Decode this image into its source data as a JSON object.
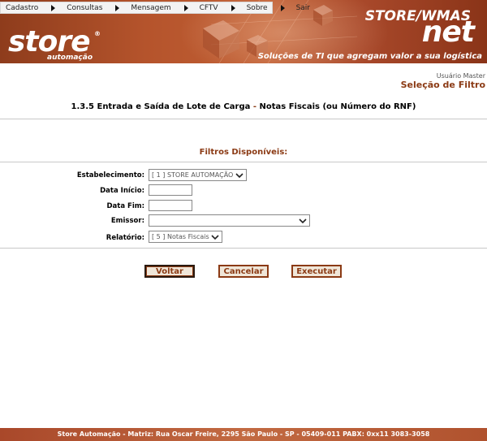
{
  "menu": {
    "items": [
      {
        "label": "Cadastro"
      },
      {
        "label": "Consultas"
      },
      {
        "label": "Mensagem"
      },
      {
        "label": "CFTV"
      },
      {
        "label": "Sobre"
      },
      {
        "label": "Sair"
      }
    ]
  },
  "header": {
    "logo_text": "store",
    "logo_reg": "®",
    "logo_subtitle": "automação",
    "brand_top": "STORE/WMAS",
    "brand_net": "net",
    "tagline": "Soluções de TI que agregam valor a sua logística"
  },
  "user": {
    "name": "Usuário Master",
    "page_kind": "Seleção de Filtro"
  },
  "page": {
    "title_part1": "1.3.5 Entrada e Saída de Lote de Carga",
    "title_sep": " - ",
    "title_part2": "Notas Fiscais (ou Número do RNF)"
  },
  "filters": {
    "title": "Filtros Disponíveis:",
    "estabelecimento_label": "Estabelecimento:",
    "estabelecimento_value": "[ 1 ] STORE AUTOMAÇÃO",
    "data_inicio_label": "Data Início:",
    "data_inicio_value": "",
    "data_fim_label": "Data Fim:",
    "data_fim_value": "",
    "emissor_label": "Emissor:",
    "emissor_value": "",
    "relatorio_label": "Relatório:",
    "relatorio_value": "[ 5 ] Notas Fiscais"
  },
  "buttons": {
    "voltar": "Voltar",
    "cancelar": "Cancelar",
    "executar": "Executar"
  },
  "footer": {
    "text": "Store Automação - Matriz: Rua Oscar Freire, 2295 São Paulo - SP - 05409-011 PABX: 0xx11 3083-3058"
  },
  "colors": {
    "brand": "#8b3a14",
    "banner": "#b5542c"
  }
}
